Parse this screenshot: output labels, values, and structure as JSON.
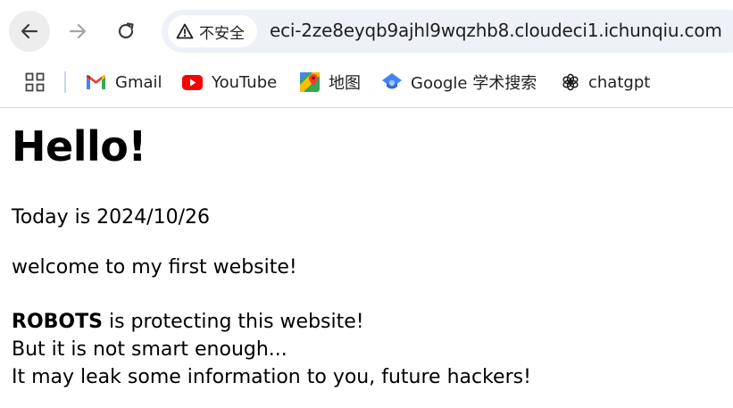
{
  "browser": {
    "security_label": "不安全",
    "url": "eci-2ze8eyqb9ajhl9wqzhb8.cloudeci1.ichunqiu.com",
    "bookmarks": [
      {
        "label": "Gmail",
        "icon": "gmail-icon"
      },
      {
        "label": "YouTube",
        "icon": "youtube-icon"
      },
      {
        "label": "地图",
        "icon": "maps-icon"
      },
      {
        "label": "Google 学术搜索",
        "icon": "scholar-icon"
      },
      {
        "label": "chatgpt",
        "icon": "chatgpt-icon"
      }
    ]
  },
  "page": {
    "heading": "Hello!",
    "date_line": "Today is 2024/10/26",
    "welcome_line": "welcome to my first website!",
    "robots_bold": "ROBOTS",
    "robots_rest": " is protecting this website!",
    "smart_line": "But it is not smart enough...",
    "leak_line": "It may leak some information to you, future hackers!"
  },
  "colors": {
    "omnibox_bg": "#eef1f8",
    "back_button_bg": "#ededed",
    "youtube_red": "#ff0000",
    "scholar_blue": "#4285f4"
  }
}
